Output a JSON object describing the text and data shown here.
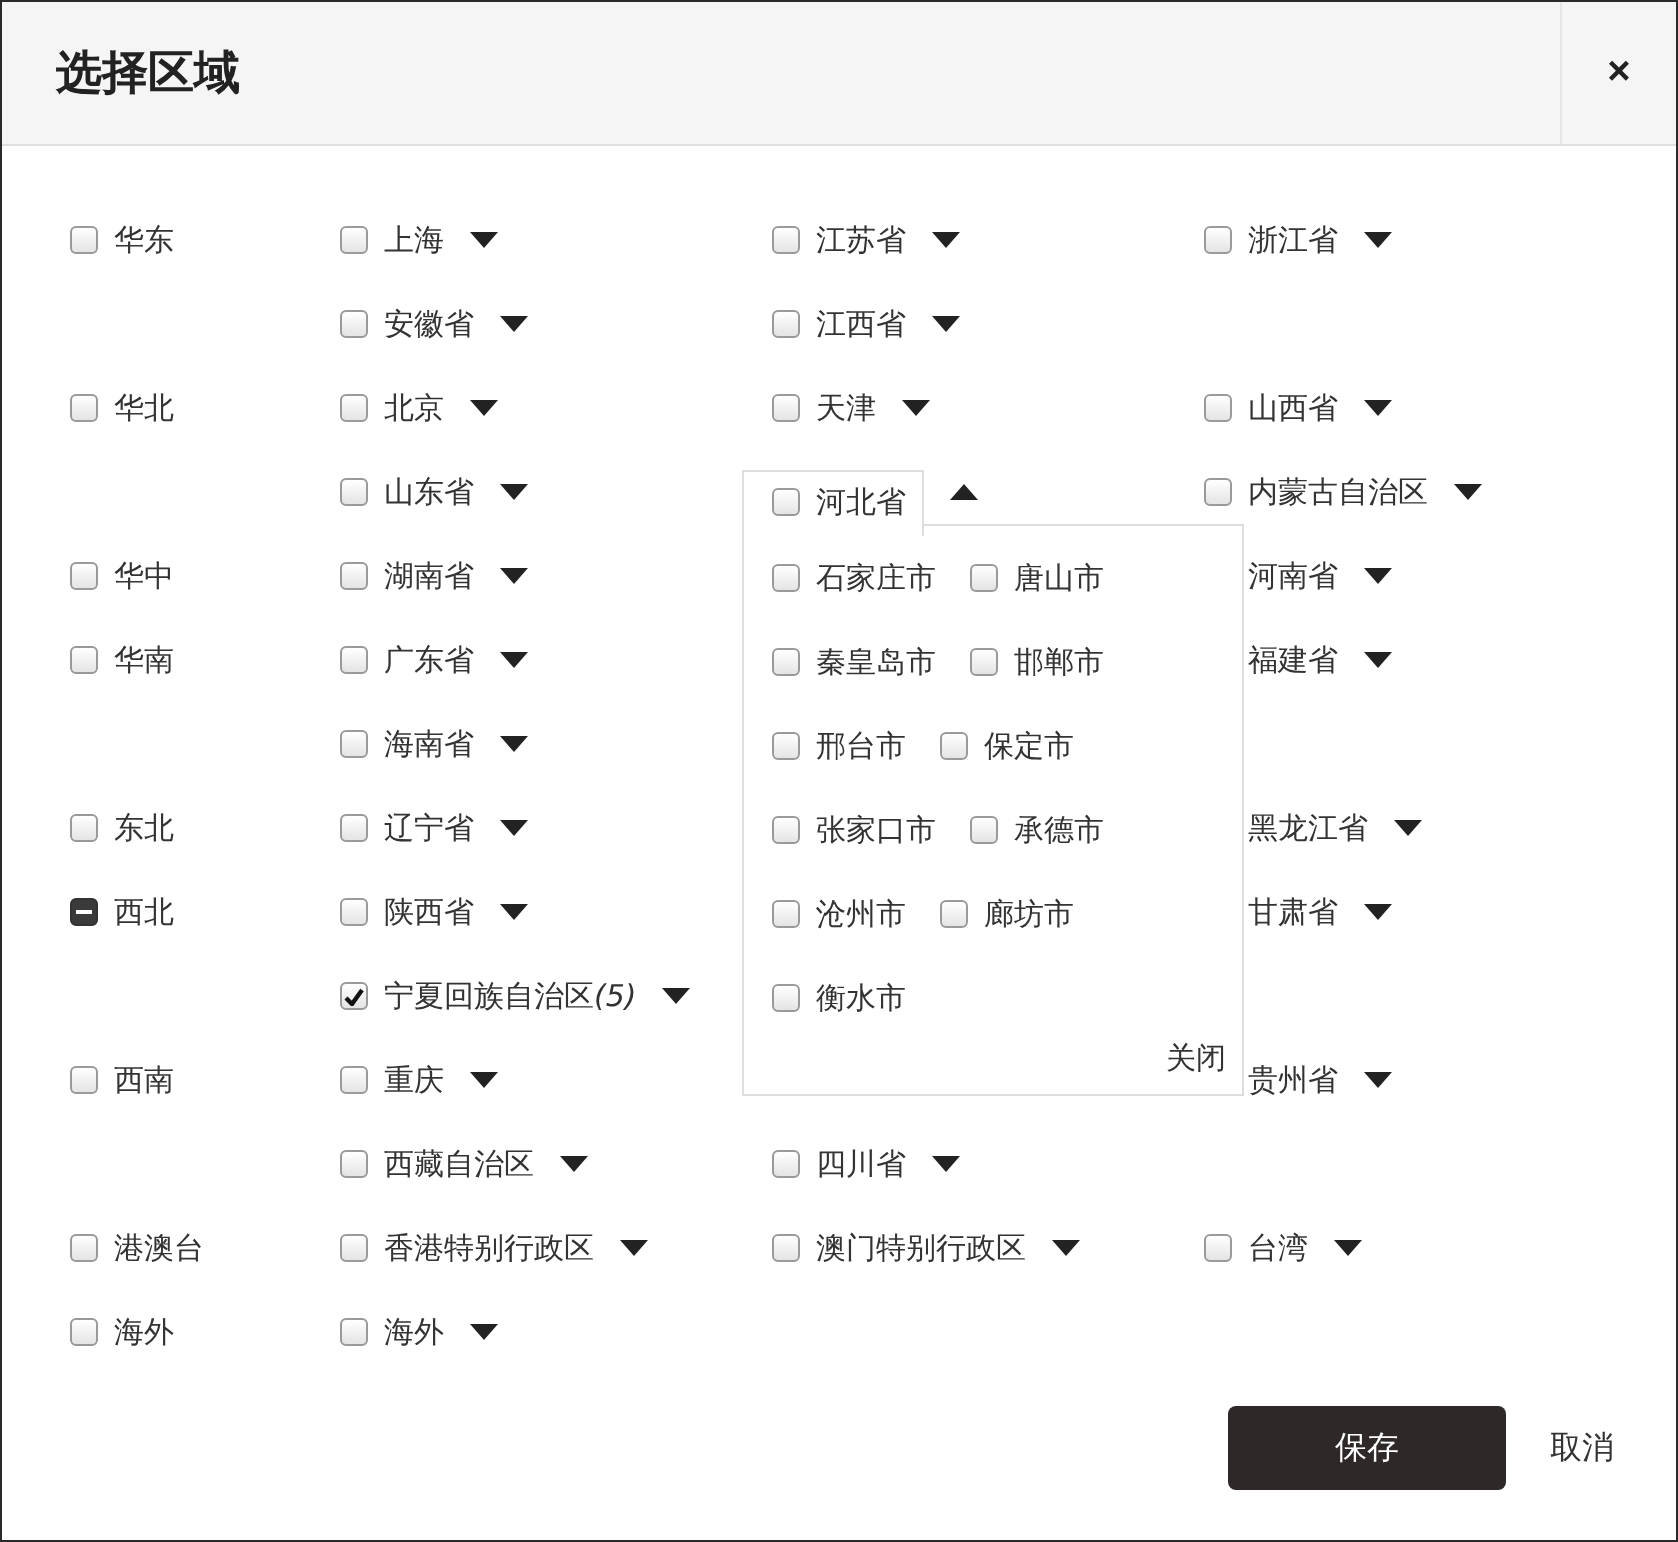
{
  "dialog": {
    "title": "选择区域",
    "close": "×"
  },
  "rows": [
    {
      "region": {
        "label": "华东",
        "checked": false,
        "indeterminate": false
      },
      "column_1": {
        "label": "上海",
        "kind": "check",
        "checked": false,
        "expanded": false
      },
      "column_2": {
        "label": "江苏省",
        "kind": "check",
        "checked": false,
        "expanded": false
      },
      "column_3": {
        "label": "浙江省",
        "kind": "check",
        "checked": false,
        "expanded": false
      }
    },
    {
      "column_1": {
        "label": "安徽省",
        "kind": "check",
        "checked": false,
        "expanded": false
      },
      "column_2": {
        "label": "江西省",
        "kind": "check",
        "checked": false,
        "expanded": false
      }
    },
    {
      "region": {
        "label": "华北",
        "checked": false,
        "indeterminate": false
      },
      "column_1": {
        "label": "北京",
        "kind": "check",
        "checked": false,
        "expanded": false
      },
      "column_2": {
        "label": "天津",
        "kind": "check",
        "checked": false,
        "expanded": false
      },
      "column_3": {
        "label": "山西省",
        "kind": "check",
        "checked": false,
        "expanded": false
      }
    },
    {
      "column_1": {
        "label": "山东省",
        "kind": "check",
        "checked": false,
        "expanded": false
      },
      "column_2": {
        "label": "河北省",
        "kind": "check",
        "checked": false,
        "expanded": true,
        "cities": [
          {
            "label": "石家庄市",
            "checked": false
          },
          {
            "label": "唐山市",
            "checked": false
          },
          {
            "label": "秦皇岛市",
            "checked": false
          },
          {
            "label": "邯郸市",
            "checked": false
          },
          {
            "label": "邢台市",
            "checked": false
          },
          {
            "label": "保定市",
            "checked": false
          },
          {
            "label": "张家口市",
            "checked": false
          },
          {
            "label": "承德市",
            "checked": false
          },
          {
            "label": "沧州市",
            "checked": false
          },
          {
            "label": "廊坊市",
            "checked": false
          },
          {
            "label": "衡水市",
            "checked": false
          }
        ],
        "close": "关闭"
      },
      "column_3": {
        "label": "内蒙古自治区",
        "kind": "check",
        "checked": false,
        "expanded": false
      }
    },
    {
      "region": {
        "label": "华中",
        "checked": false,
        "indeterminate": false
      },
      "column_1": {
        "label": "湖南省",
        "kind": "check",
        "checked": false,
        "expanded": false
      },
      "column_3": {
        "label": "河南省",
        "kind": "covered",
        "expanded": false
      }
    },
    {
      "region": {
        "label": "华南",
        "checked": false,
        "indeterminate": false
      },
      "column_1": {
        "label": "广东省",
        "kind": "check",
        "checked": false,
        "expanded": false
      },
      "column_3": {
        "label": "福建省",
        "kind": "covered",
        "expanded": false
      }
    },
    {
      "column_1": {
        "label": "海南省",
        "kind": "check",
        "checked": false,
        "expanded": false
      }
    },
    {
      "region": {
        "label": "东北",
        "checked": false,
        "indeterminate": false
      },
      "column_1": {
        "label": "辽宁省",
        "kind": "check",
        "checked": false,
        "expanded": false
      },
      "column_3": {
        "label": "黑龙江省",
        "kind": "covered",
        "expanded": false
      }
    },
    {
      "region": {
        "label": "西北",
        "checked": false,
        "indeterminate": true
      },
      "column_1": {
        "label": "陕西省",
        "kind": "check",
        "checked": false,
        "expanded": false
      },
      "column_3": {
        "label": "甘肃省",
        "kind": "covered",
        "expanded": false
      }
    },
    {
      "column_1": {
        "label": "宁夏回族自治区",
        "count": "(5)",
        "kind": "check",
        "checked": true,
        "expanded": false
      }
    },
    {
      "region": {
        "label": "西南",
        "checked": false,
        "indeterminate": false
      },
      "column_1": {
        "label": "重庆",
        "kind": "check",
        "checked": false,
        "expanded": false
      },
      "column_3": {
        "label": "贵州省",
        "kind": "covered",
        "expanded": false
      }
    },
    {
      "column_1": {
        "label": "西藏自治区",
        "kind": "check",
        "checked": false,
        "expanded": false
      },
      "column_2": {
        "label": "四川省",
        "kind": "check",
        "checked": false,
        "expanded": false
      }
    },
    {
      "region": {
        "label": "港澳台",
        "checked": false,
        "indeterminate": false
      },
      "column_1": {
        "label": "香港特别行政区",
        "kind": "check",
        "checked": false,
        "expanded": false
      },
      "column_2": {
        "label": "澳门特别行政区",
        "kind": "check",
        "checked": false,
        "expanded": false
      },
      "column_3": {
        "label": "台湾",
        "kind": "check",
        "checked": false,
        "expanded": false
      }
    },
    {
      "region": {
        "label": "海外",
        "checked": false,
        "indeterminate": false
      },
      "column_1": {
        "label": "海外",
        "kind": "check",
        "checked": false,
        "expanded": false
      }
    }
  ],
  "buttons": [
    {
      "label": "保存",
      "kind": "primary"
    },
    {
      "label": "取消",
      "kind": "link"
    }
  ]
}
